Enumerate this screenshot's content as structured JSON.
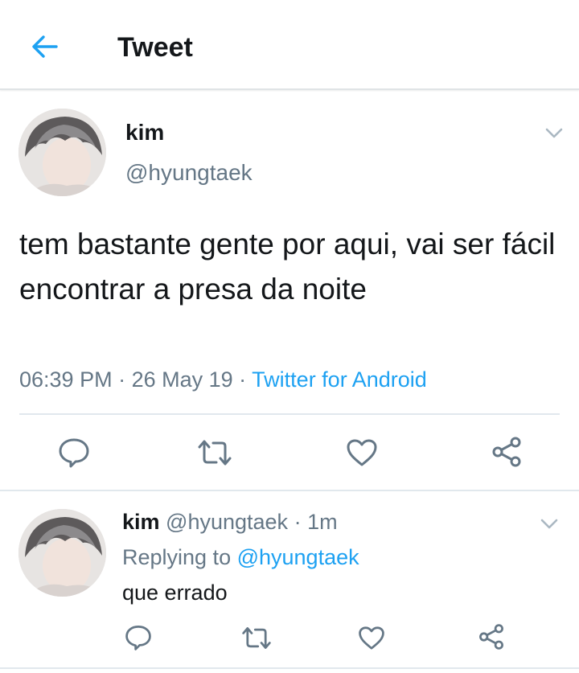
{
  "header": {
    "title": "Tweet",
    "back_icon": "arrow-left-icon"
  },
  "colors": {
    "accent": "#1da1f2",
    "secondary_text": "#657786",
    "primary_text": "#14171a",
    "divider": "#e1e8ed"
  },
  "tweet": {
    "display_name": "kim",
    "handle": "@hyungtaek",
    "text": "tem bastante gente por aqui, vai ser fácil encontrar a presa da noite",
    "time": "06:39 PM",
    "date": "26 May 19",
    "separator": " · ",
    "source": "Twitter for Android",
    "actions": [
      "reply-icon",
      "retweet-icon",
      "like-icon",
      "share-icon"
    ]
  },
  "reply": {
    "display_name": "kim",
    "handle": "@hyungtaek",
    "age": "1m",
    "separator": " · ",
    "replying_prefix": "Replying to ",
    "replying_to": "@hyungtaek",
    "text": "que errado",
    "actions": [
      "reply-icon",
      "retweet-icon",
      "like-icon",
      "share-icon"
    ]
  }
}
